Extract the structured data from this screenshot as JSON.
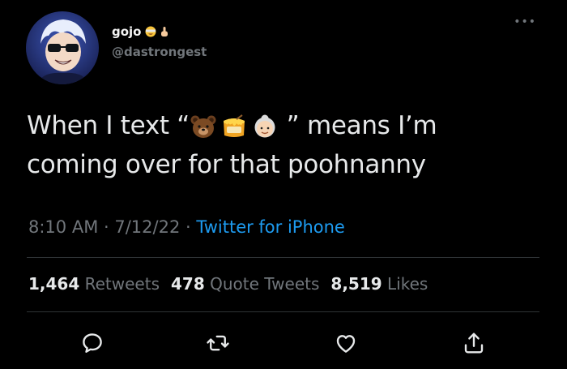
{
  "user": {
    "display_name": "gojo",
    "handle": "@dastrongest",
    "name_emojis": [
      "grinning-face-with-blindfold-emoji",
      "finger-pointing-up-emoji"
    ]
  },
  "tweet": {
    "line1_before": "When I text “",
    "line1_after": " ” means I’m",
    "line2": "coming over for that poohnanny",
    "emojis": [
      "bear-emoji",
      "honey-pot-emoji",
      "old-woman-emoji"
    ]
  },
  "meta": {
    "time": "8:10 AM",
    "separator1": " · ",
    "date": "7/12/22",
    "separator2": " · ",
    "source": "Twitter for iPhone"
  },
  "stats": {
    "retweets_count": "1,464",
    "retweets_label": "Retweets",
    "quotes_count": "478",
    "quotes_label": "Quote Tweets",
    "likes_count": "8,519",
    "likes_label": "Likes"
  },
  "actions": [
    "reply-icon",
    "retweet-icon",
    "like-icon",
    "share-icon"
  ],
  "colors": {
    "background": "#000000",
    "text": "#e7e9ea",
    "secondary": "#71767b",
    "link": "#1d9bf0",
    "divider": "#2f3336"
  }
}
